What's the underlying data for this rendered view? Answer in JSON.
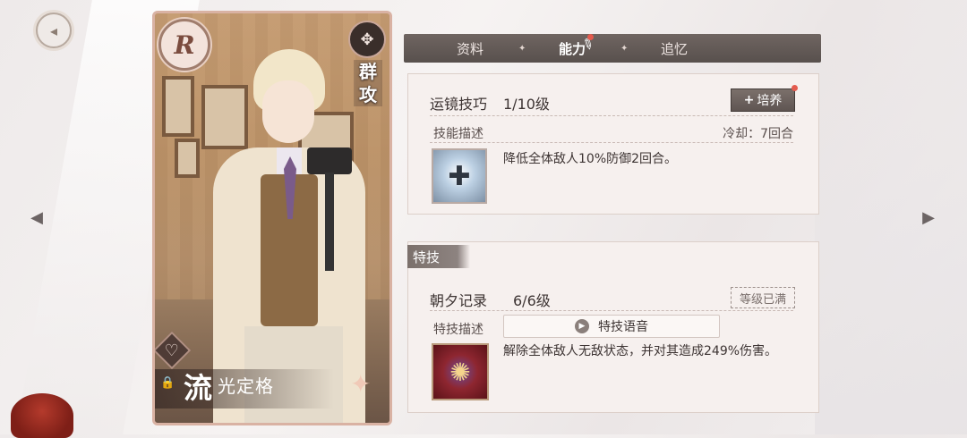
{
  "nav": {
    "back_icon": "back-arrow-icon",
    "left_arrow_icon": "left-arrow-icon",
    "right_arrow_icon": "right-arrow-icon"
  },
  "card": {
    "rarity": "R",
    "attack_type": "群攻",
    "name_first": "流",
    "name_rest": "光定格",
    "heart_icon": "heart-icon",
    "lock_icon": "lock-icon"
  },
  "tabs": [
    {
      "label": "资料"
    },
    {
      "label": "能力"
    },
    {
      "label": "追忆"
    }
  ],
  "skill": {
    "name": "运镜技巧",
    "level": "1/10级",
    "train_label": "培养",
    "desc_label": "技能描述",
    "cooldown": "冷却：7回合",
    "description": "降低全体敌人10%防御2回合。"
  },
  "special": {
    "tag": "特技",
    "name": "朝夕记录",
    "level": "6/6级",
    "maxed_label": "等级已满",
    "desc_label": "特技描述",
    "voice_label": "特技语音",
    "description": "解除全体敌人无敌状态，并对其造成249%伤害。"
  },
  "colors": {
    "notification_dot": "#e45b4e",
    "tab_bar": "#5f5552"
  }
}
